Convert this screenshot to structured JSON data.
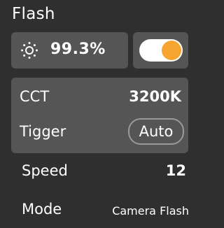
{
  "panel": {
    "title": "Flash"
  },
  "brightness": {
    "value": "99.3%",
    "icon": "sun-icon"
  },
  "toggle": {
    "state": "on",
    "knob_color": "#f6a531",
    "track_color": "#ffffff"
  },
  "params": {
    "cct_label": "CCT",
    "cct_value": "3200K",
    "trigger_label": "Tigger",
    "trigger_value": "Auto"
  },
  "speed": {
    "label": "Speed",
    "value": "12"
  },
  "mode": {
    "label": "Mode",
    "value": "Camera Flash"
  },
  "colors": {
    "background": "#2f2f2f",
    "card": "#555555",
    "accent": "#f6a531",
    "text": "#ffffff"
  }
}
